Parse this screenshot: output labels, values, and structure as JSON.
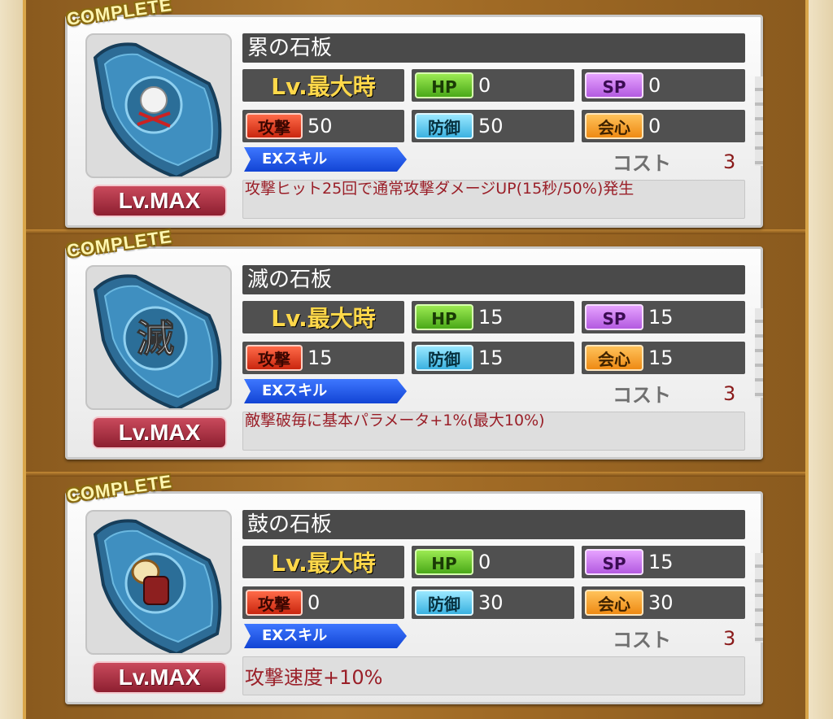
{
  "labels": {
    "complete": "COMPLETE",
    "lv_max": "Lv.MAX",
    "lv_max_time": "Lv.最大時",
    "hp": "HP",
    "sp": "SP",
    "attack": "攻撃",
    "defense": "防御",
    "critical": "会心",
    "ex_skill": "EXスキル",
    "cost": "コスト"
  },
  "tablets": [
    {
      "name": "累の石板",
      "icon": "spider-flower-emblem-icon",
      "hp": "0",
      "sp": "0",
      "attack": "50",
      "defense": "50",
      "critical": "0",
      "cost": "3",
      "skill_desc": "攻撃ヒット25回で通常攻撃ダメージUP(15秒/50%)発生"
    },
    {
      "name": "滅の石板",
      "icon": "kanji-metsu-emblem-icon",
      "glyph": "滅",
      "hp": "15",
      "sp": "15",
      "attack": "15",
      "defense": "15",
      "critical": "15",
      "cost": "3",
      "skill_desc": "敵撃破毎に基本パラメータ+1%(最大10%)"
    },
    {
      "name": "鼓の石板",
      "icon": "drum-emblem-icon",
      "hp": "0",
      "sp": "15",
      "attack": "0",
      "defense": "30",
      "critical": "30",
      "cost": "3",
      "skill_desc": "攻撃速度+10%"
    }
  ]
}
